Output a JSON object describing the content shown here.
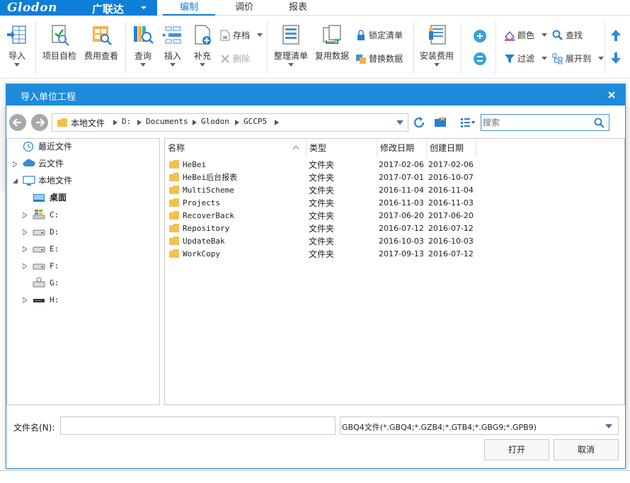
{
  "app": {
    "logo_name": "Glodon",
    "logo_cn": "广联达",
    "tabs": [
      "编制",
      "调价",
      "报表"
    ]
  },
  "ribbon": {
    "import": "导入",
    "self_check": "项目自检",
    "fee_view": "费用查看",
    "query": "查询",
    "insert": "插入",
    "supplement": "补充",
    "save_archive": "存档",
    "delete": "删除",
    "organize_list": "整理清单",
    "reuse_data": "复用数据",
    "lock_list": "锁定清单",
    "replace_data": "替换数据",
    "install_fee": "安装费用",
    "color": "颜色",
    "filter": "过滤",
    "find": "查找",
    "expand_to": "展开到"
  },
  "dialog": {
    "title": "导入单位工程",
    "path": [
      "本地文件",
      "D:",
      "Documents",
      "Glodon",
      "GCCP5"
    ],
    "search_placeholder": "搜索",
    "tree": {
      "recent": "最近文件",
      "cloud": "云文件",
      "local": "本地文件",
      "desktop": "桌面",
      "drives": [
        "C:",
        "D:",
        "E:",
        "F:",
        "G:",
        "H:"
      ]
    },
    "columns": [
      "名称",
      "类型",
      "修改日期",
      "创建日期"
    ],
    "files": [
      {
        "name": "HeBei",
        "type": "文件夹",
        "modified": "2017-02-06",
        "created": "2017-02-06"
      },
      {
        "name": "HeBei后台报表",
        "type": "文件夹",
        "modified": "2017-07-01",
        "created": "2016-10-07"
      },
      {
        "name": "MultiScheme",
        "type": "文件夹",
        "modified": "2016-11-04",
        "created": "2016-11-04"
      },
      {
        "name": "Projects",
        "type": "文件夹",
        "modified": "2016-11-03",
        "created": "2016-11-03"
      },
      {
        "name": "RecoverBack",
        "type": "文件夹",
        "modified": "2017-06-20",
        "created": "2017-06-20"
      },
      {
        "name": "Repository",
        "type": "文件夹",
        "modified": "2016-07-12",
        "created": "2016-07-12"
      },
      {
        "name": "UpdateBak",
        "type": "文件夹",
        "modified": "2016-10-03",
        "created": "2016-10-03"
      },
      {
        "name": "WorkCopy",
        "type": "文件夹",
        "modified": "2017-09-13",
        "created": "2016-07-12"
      }
    ],
    "filename_label": "文件名(N):",
    "filename_value": "",
    "filter_value": "GBQ4文件(*.GBQ4;*.GZB4;*.GTB4;*.GBG9;*.GPB9)",
    "open_button": "打开",
    "cancel_button": "取消"
  },
  "colors": {
    "brand_blue": "#0e7ed6",
    "title_blue": "#1d8bd9",
    "folder_yellow": "#f2c14e"
  }
}
